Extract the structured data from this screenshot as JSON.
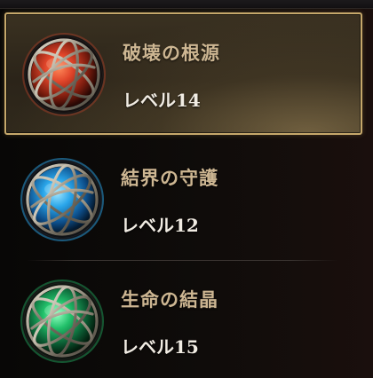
{
  "orbs": [
    {
      "name": "破壊の根源",
      "level": "レベル14",
      "core_color": "#e0452a",
      "glow_color": "#7a1c0e",
      "selected": true
    },
    {
      "name": "結界の守護",
      "level": "レベル12",
      "core_color": "#2aa6ea",
      "glow_color": "#0d4e8a",
      "selected": false
    },
    {
      "name": "生命の結晶",
      "level": "レベル15",
      "core_color": "#22c06a",
      "glow_color": "#0b5a32",
      "selected": false
    }
  ],
  "colors": {
    "selection_border": "#c6a86b",
    "name_text": "#cdb692",
    "level_text": "#f1ece3",
    "background": "#0b0908"
  }
}
